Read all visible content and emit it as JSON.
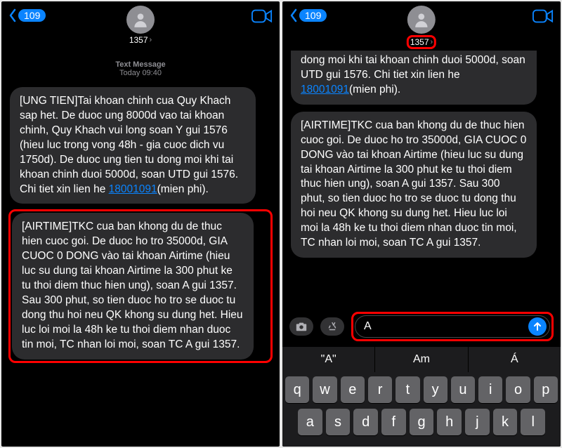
{
  "left": {
    "back_badge": "109",
    "contact_name": "1357",
    "meta_label": "Text Message",
    "meta_time": "Today 09:40",
    "msg1_pre": "[UNG TIEN]Tai khoan chinh cua Quy Khach sap het. De duoc ung 8000d vao tai khoan chinh, Quy Khach vui long soan Y gui 1576 (hieu luc trong vong 48h - gia cuoc dich vu 1750d). De duoc ung tien tu dong moi khi tai khoan chinh duoi 5000d, soan UTD gui 1576. Chi tiet xin lien he ",
    "msg1_link": "18001091",
    "msg1_post": "(mien phi).",
    "msg2": "[AIRTIME]TKC cua ban khong du de thuc hien cuoc goi. De duoc ho tro 35000d, GIA CUOC 0 DONG vào tai khoan Airtime (hieu luc su dung tai khoan Airtime la 300 phut ke tu thoi diem thuc hien ung), soan A gui 1357. Sau 300 phut, so tien duoc ho tro se duoc tu dong thu hoi neu QK khong su dung het. Hieu luc loi moi la 48h ke tu thoi diem nhan duoc tin moi, TC nhan loi moi, soan TC A gui 1357."
  },
  "right": {
    "back_badge": "109",
    "contact_name": "1357",
    "msg1_pre": "dong moi khi tai khoan chinh duoi 5000d, soan UTD gui 1576. Chi tiet xin lien he ",
    "msg1_link": "18001091",
    "msg1_post": "(mien phi).",
    "msg2": "[AIRTIME]TKC cua ban khong du de thuc hien cuoc goi. De duoc ho tro 35000d, GIA CUOC 0 DONG vào tai khoan Airtime (hieu luc su dung tai khoan Airtime la 300 phut ke tu thoi diem thuc hien ung), soan A gui 1357. Sau 300 phut, so tien duoc ho tro se duoc tu dong thu hoi neu QK khong su dung het. Hieu luc loi moi la 48h ke tu thoi diem nhan duoc tin moi, TC nhan loi moi, soan TC A gui 1357.",
    "input_value": "A",
    "suggestions": [
      "\"A\"",
      "Am",
      "Á"
    ],
    "keyboard_rows": [
      [
        "q",
        "w",
        "e",
        "r",
        "t",
        "y",
        "u",
        "i",
        "o",
        "p"
      ],
      [
        "a",
        "s",
        "d",
        "f",
        "g",
        "h",
        "j",
        "k",
        "l"
      ]
    ]
  }
}
